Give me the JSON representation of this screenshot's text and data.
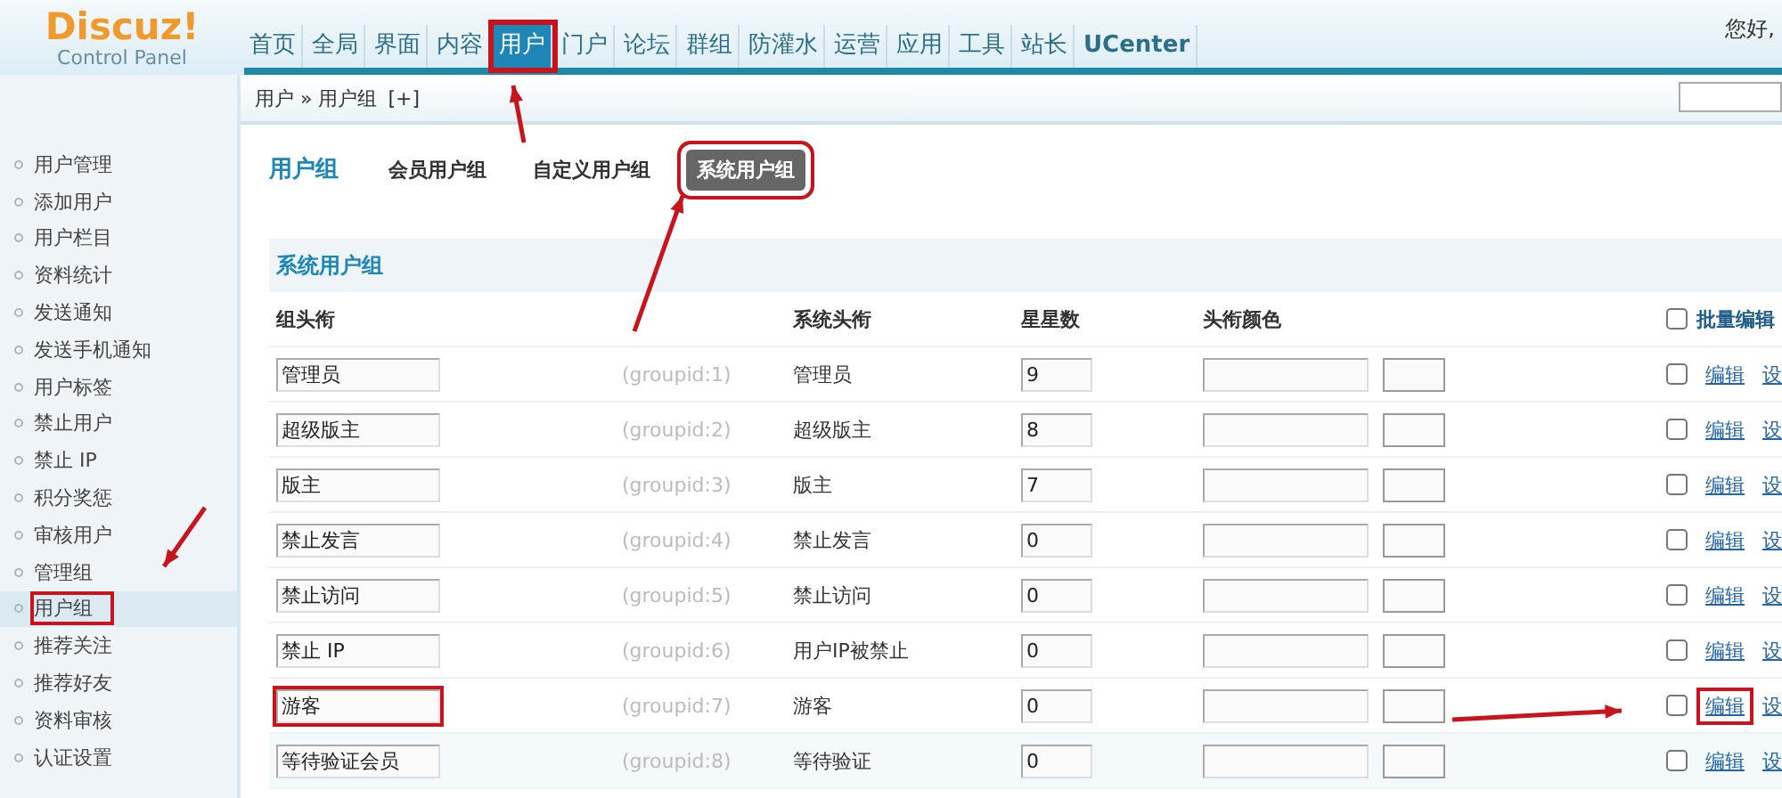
{
  "logo": {
    "title": "Discuz!",
    "subtitle": "Control Panel"
  },
  "nav": [
    {
      "label": "首页",
      "selected": false,
      "annotated": false
    },
    {
      "label": "全局",
      "selected": false,
      "annotated": false
    },
    {
      "label": "界面",
      "selected": false,
      "annotated": false
    },
    {
      "label": "内容",
      "selected": false,
      "annotated": false
    },
    {
      "label": "用户",
      "selected": true,
      "annotated": true
    },
    {
      "label": "门户",
      "selected": false,
      "annotated": false
    },
    {
      "label": "论坛",
      "selected": false,
      "annotated": false
    },
    {
      "label": "群组",
      "selected": false,
      "annotated": false
    },
    {
      "label": "防灌水",
      "selected": false,
      "annotated": false
    },
    {
      "label": "运营",
      "selected": false,
      "annotated": false
    },
    {
      "label": "应用",
      "selected": false,
      "annotated": false
    },
    {
      "label": "工具",
      "selected": false,
      "annotated": false
    },
    {
      "label": "站长",
      "selected": false,
      "annotated": false
    },
    {
      "label": "UCenter",
      "selected": false,
      "annotated": false
    }
  ],
  "greeting": "您好,",
  "breadcrumb": {
    "path": "用户 » 用户组",
    "add": "[+]"
  },
  "sidebar": {
    "items": [
      {
        "label": "用户管理",
        "selected": false,
        "annotated": false
      },
      {
        "label": "添加用户",
        "selected": false,
        "annotated": false
      },
      {
        "label": "用户栏目",
        "selected": false,
        "annotated": false
      },
      {
        "label": "资料统计",
        "selected": false,
        "annotated": false
      },
      {
        "label": "发送通知",
        "selected": false,
        "annotated": false
      },
      {
        "label": "发送手机通知",
        "selected": false,
        "annotated": false
      },
      {
        "label": "用户标签",
        "selected": false,
        "annotated": false
      },
      {
        "label": "禁止用户",
        "selected": false,
        "annotated": false
      },
      {
        "label": "禁止 IP",
        "selected": false,
        "annotated": false
      },
      {
        "label": "积分奖惩",
        "selected": false,
        "annotated": false
      },
      {
        "label": "审核用户",
        "selected": false,
        "annotated": false
      },
      {
        "label": "管理组",
        "selected": false,
        "annotated": false
      },
      {
        "label": "用户组",
        "selected": true,
        "annotated": true
      },
      {
        "label": "推荐关注",
        "selected": false,
        "annotated": false
      },
      {
        "label": "推荐好友",
        "selected": false,
        "annotated": false
      },
      {
        "label": "资料审核",
        "selected": false,
        "annotated": false
      },
      {
        "label": "认证设置",
        "selected": false,
        "annotated": false
      }
    ]
  },
  "page_title": "用户组",
  "subtabs": [
    {
      "label": "会员用户组",
      "selected": false,
      "annotated": false
    },
    {
      "label": "自定义用户组",
      "selected": false,
      "annotated": false
    },
    {
      "label": "系统用户组",
      "selected": true,
      "annotated": true
    }
  ],
  "section_title": "系统用户组",
  "table": {
    "columns": [
      "组头衔",
      "系统头衔",
      "星星数",
      "头衔颜色"
    ],
    "batch": {
      "label": "批量编辑",
      "checked": false
    },
    "rows": [
      {
        "name": "管理员",
        "groupid": "(groupid:1)",
        "system_title": "管理员",
        "stars": "9",
        "checked": false,
        "edit": "编辑",
        "settings": "设",
        "name_annotated": false,
        "edit_annotated": false
      },
      {
        "name": "超级版主",
        "groupid": "(groupid:2)",
        "system_title": "超级版主",
        "stars": "8",
        "checked": false,
        "edit": "编辑",
        "settings": "设",
        "name_annotated": false,
        "edit_annotated": false
      },
      {
        "name": "版主",
        "groupid": "(groupid:3)",
        "system_title": "版主",
        "stars": "7",
        "checked": false,
        "edit": "编辑",
        "settings": "设",
        "name_annotated": false,
        "edit_annotated": false
      },
      {
        "name": "禁止发言",
        "groupid": "(groupid:4)",
        "system_title": "禁止发言",
        "stars": "0",
        "checked": false,
        "edit": "编辑",
        "settings": "设",
        "name_annotated": false,
        "edit_annotated": false
      },
      {
        "name": "禁止访问",
        "groupid": "(groupid:5)",
        "system_title": "禁止访问",
        "stars": "0",
        "checked": false,
        "edit": "编辑",
        "settings": "设",
        "name_annotated": false,
        "edit_annotated": false
      },
      {
        "name": "禁止 IP",
        "groupid": "(groupid:6)",
        "system_title": "用户IP被禁止",
        "stars": "0",
        "checked": false,
        "edit": "编辑",
        "settings": "设",
        "name_annotated": false,
        "edit_annotated": false
      },
      {
        "name": "游客",
        "groupid": "(groupid:7)",
        "system_title": "游客",
        "stars": "0",
        "checked": false,
        "edit": "编辑",
        "settings": "设",
        "name_annotated": true,
        "edit_annotated": true
      },
      {
        "name": "等待验证会员",
        "groupid": "(groupid:8)",
        "system_title": "等待验证",
        "stars": "0",
        "checked": false,
        "edit": "编辑",
        "settings": "设",
        "name_annotated": false,
        "edit_annotated": false
      }
    ]
  }
}
